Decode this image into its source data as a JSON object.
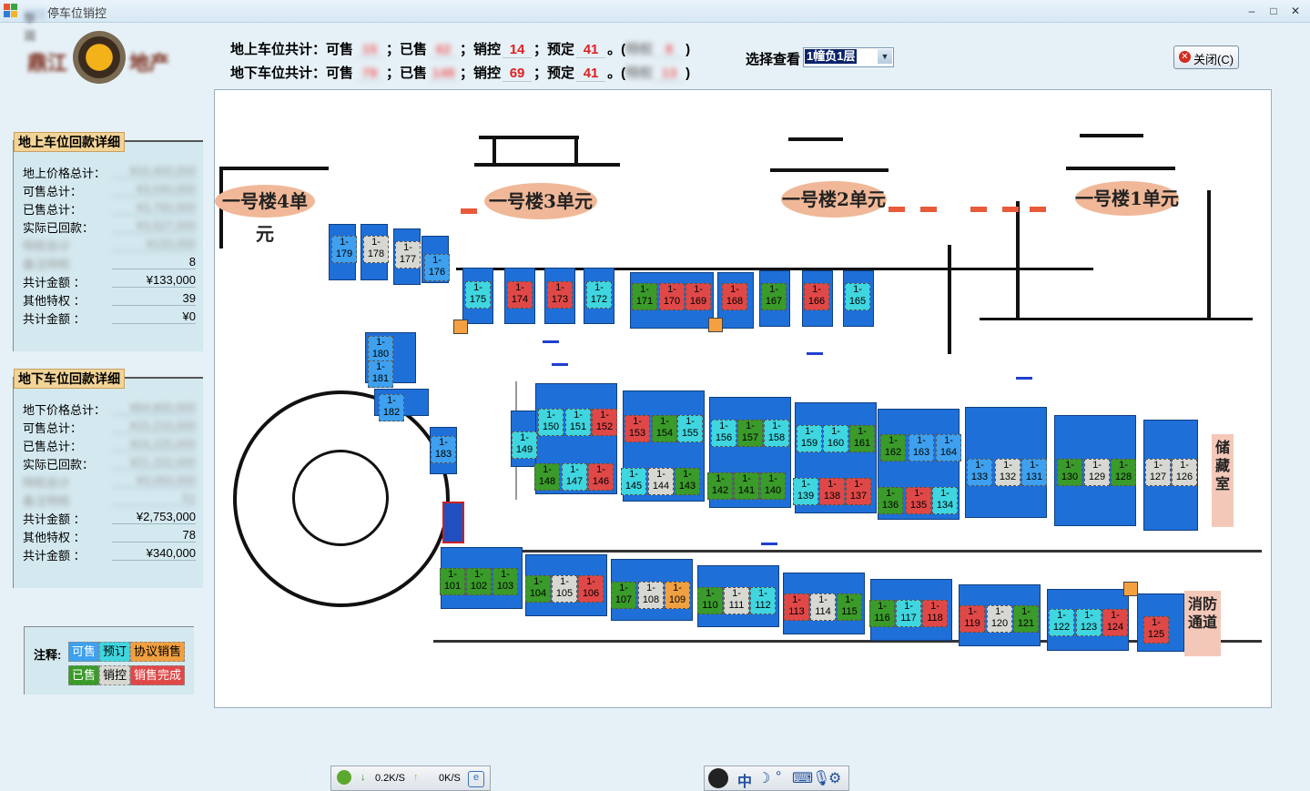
{
  "window": {
    "title": "停车位销控",
    "title_blurred_prefix": "华润"
  },
  "controls": {
    "minimize": "–",
    "maximize": "□",
    "close": "✕"
  },
  "logo": {
    "left": "鼎江",
    "right": "地产"
  },
  "summary": {
    "above": {
      "label": "地上车位共计：可售",
      "available": "15",
      "sold_label": "；已售",
      "sold": "62",
      "control_label": "；销控",
      "control": "14",
      "reserved_label": "；预定",
      "reserved": "41",
      "tail_open": "。(",
      "extra_label": "特权",
      "extra": "8",
      "tail_close": ")"
    },
    "below": {
      "label": "地下车位共计：可售",
      "available": "79",
      "sold_label": "；已售",
      "sold": "148",
      "control_label": "；销控",
      "control": "69",
      "reserved_label": "；预定",
      "reserved": "41",
      "tail_open": "。(",
      "extra_label": "特权",
      "extra": "13",
      "tail_close": ")"
    }
  },
  "view_select": {
    "label": "选择查看",
    "selected": "1幢负1层"
  },
  "close_button": {
    "label": "关闭(C)"
  },
  "panel_above": {
    "title": "地上车位回款详细",
    "rows": [
      {
        "k": "地上价格总计：",
        "v": "¥10,400,000",
        "blur": true
      },
      {
        "k": "可售总计：",
        "v": "¥3,040,000",
        "blur": true
      },
      {
        "k": "已售总计：",
        "v": "¥3,760,000",
        "blur": true
      },
      {
        "k": "实际已回款：",
        "v": "¥3,627,000",
        "blur": true
      },
      {
        "k": "特权总计",
        "v": "¥133,000",
        "blur": true,
        "kblur": true
      },
      {
        "k": "备注特权",
        "v": "8",
        "blur": false,
        "kblur": true
      },
      {
        "k": "共计金额  ：",
        "v": "¥133,000",
        "blur": false
      },
      {
        "k": "其他特权  ：",
        "v": "39",
        "blur": false
      },
      {
        "k": "共计金额  ：",
        "v": "¥0",
        "blur": false
      }
    ]
  },
  "panel_below": {
    "title": "地下车位回款详细",
    "rows": [
      {
        "k": "地下价格总计：",
        "v": "¥64,800,000",
        "blur": true
      },
      {
        "k": "可售总计：",
        "v": "¥15,210,000",
        "blur": true
      },
      {
        "k": "已售总计：",
        "v": "¥24,225,000",
        "blur": true
      },
      {
        "k": "实际已回款：",
        "v": "¥21,152,000",
        "blur": true
      },
      {
        "k": "特权总计",
        "v": "¥3,093,000",
        "blur": true,
        "kblur": true
      },
      {
        "k": "备注特权",
        "v": "51",
        "blur": true,
        "kblur": true
      },
      {
        "k": "共计金额  ：",
        "v": "¥2,753,000",
        "blur": false
      },
      {
        "k": "其他特权  ：",
        "v": "78",
        "blur": false
      },
      {
        "k": "共计金额  ：",
        "v": "¥340,000",
        "blur": false
      }
    ]
  },
  "legend": {
    "title": "注释:",
    "items": [
      {
        "label": "可售",
        "color": "#3ea0ee"
      },
      {
        "label": "预订",
        "color": "#3fd6e0"
      },
      {
        "label": "协议销售",
        "color": "#f0a040"
      },
      {
        "label": "已售",
        "color": "#3a9a2a"
      },
      {
        "label": "销控",
        "color": "#d8d8d2"
      },
      {
        "label": "销售完成",
        "color": "#e04848"
      }
    ]
  },
  "buildings": [
    "一号楼4单元",
    "一号楼3单元",
    "一号楼2单元",
    "一号楼1单元"
  ],
  "storage_label": "储藏室",
  "fire_label": "消防通道",
  "status_bar": {
    "down": "0.2K/S",
    "up": "0K/S"
  },
  "ime": {
    "text": "中"
  },
  "spots": [
    {
      "n": "179",
      "s": "sale"
    },
    {
      "n": "178",
      "s": "control"
    },
    {
      "n": "177",
      "s": "control"
    },
    {
      "n": "176",
      "s": "sale"
    },
    {
      "n": "175",
      "s": "reserve"
    },
    {
      "n": "174",
      "s": "done"
    },
    {
      "n": "173",
      "s": "done"
    },
    {
      "n": "172",
      "s": "reserve"
    },
    {
      "n": "171",
      "s": "sold"
    },
    {
      "n": "170",
      "s": "done"
    },
    {
      "n": "169",
      "s": "done"
    },
    {
      "n": "168",
      "s": "done"
    },
    {
      "n": "167",
      "s": "sold"
    },
    {
      "n": "166",
      "s": "done"
    },
    {
      "n": "165",
      "s": "reserve"
    },
    {
      "n": "180",
      "s": "sale"
    },
    {
      "n": "181",
      "s": "sale"
    },
    {
      "n": "182",
      "s": "sale"
    },
    {
      "n": "183",
      "s": "sale"
    },
    {
      "n": "149",
      "s": "reserve"
    },
    {
      "n": "150",
      "s": "reserve"
    },
    {
      "n": "151",
      "s": "reserve"
    },
    {
      "n": "152",
      "s": "done"
    },
    {
      "n": "153",
      "s": "done"
    },
    {
      "n": "154",
      "s": "sold"
    },
    {
      "n": "155",
      "s": "reserve"
    },
    {
      "n": "156",
      "s": "reserve"
    },
    {
      "n": "157",
      "s": "sold"
    },
    {
      "n": "158",
      "s": "reserve"
    },
    {
      "n": "159",
      "s": "reserve"
    },
    {
      "n": "160",
      "s": "reserve"
    },
    {
      "n": "161",
      "s": "sold"
    },
    {
      "n": "162",
      "s": "sold"
    },
    {
      "n": "163",
      "s": "sale"
    },
    {
      "n": "164",
      "s": "sale"
    },
    {
      "n": "148",
      "s": "sold"
    },
    {
      "n": "147",
      "s": "reserve"
    },
    {
      "n": "146",
      "s": "done"
    },
    {
      "n": "145",
      "s": "reserve"
    },
    {
      "n": "144",
      "s": "control"
    },
    {
      "n": "143",
      "s": "sold"
    },
    {
      "n": "142",
      "s": "sold"
    },
    {
      "n": "141",
      "s": "sold"
    },
    {
      "n": "140",
      "s": "sold"
    },
    {
      "n": "139",
      "s": "reserve"
    },
    {
      "n": "138",
      "s": "done"
    },
    {
      "n": "137",
      "s": "done"
    },
    {
      "n": "136",
      "s": "sold"
    },
    {
      "n": "135",
      "s": "done"
    },
    {
      "n": "134",
      "s": "reserve"
    },
    {
      "n": "133",
      "s": "sale"
    },
    {
      "n": "132",
      "s": "control"
    },
    {
      "n": "131",
      "s": "sale"
    },
    {
      "n": "130",
      "s": "sold"
    },
    {
      "n": "129",
      "s": "control"
    },
    {
      "n": "128",
      "s": "sold"
    },
    {
      "n": "127",
      "s": "control"
    },
    {
      "n": "126",
      "s": "control"
    },
    {
      "n": "101",
      "s": "sold"
    },
    {
      "n": "102",
      "s": "sold"
    },
    {
      "n": "103",
      "s": "sold"
    },
    {
      "n": "104",
      "s": "sold"
    },
    {
      "n": "105",
      "s": "control"
    },
    {
      "n": "106",
      "s": "done"
    },
    {
      "n": "107",
      "s": "sold"
    },
    {
      "n": "108",
      "s": "control"
    },
    {
      "n": "109",
      "s": "agreement"
    },
    {
      "n": "110",
      "s": "sold"
    },
    {
      "n": "111",
      "s": "control"
    },
    {
      "n": "112",
      "s": "reserve"
    },
    {
      "n": "113",
      "s": "done"
    },
    {
      "n": "114",
      "s": "control"
    },
    {
      "n": "115",
      "s": "sold"
    },
    {
      "n": "116",
      "s": "sold"
    },
    {
      "n": "117",
      "s": "reserve"
    },
    {
      "n": "118",
      "s": "done"
    },
    {
      "n": "119",
      "s": "done"
    },
    {
      "n": "120",
      "s": "control"
    },
    {
      "n": "121",
      "s": "sold"
    },
    {
      "n": "122",
      "s": "reserve"
    },
    {
      "n": "123",
      "s": "reserve"
    },
    {
      "n": "124",
      "s": "done"
    },
    {
      "n": "125",
      "s": "done"
    }
  ]
}
